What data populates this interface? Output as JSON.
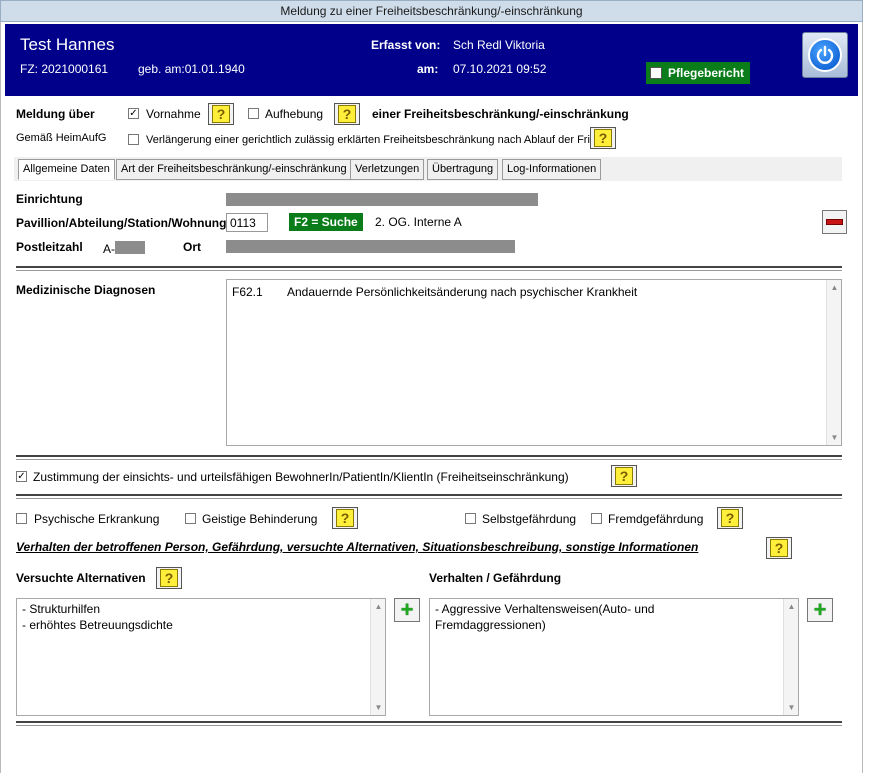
{
  "window": {
    "title": "Meldung zu einer Freiheitsbeschränkung/-einschränkung"
  },
  "header": {
    "name": "Test Hannes",
    "fz": "FZ: 2021000161",
    "geb": "geb. am:01.01.1940",
    "erfasst_label": "Erfasst von:",
    "erfasst_value": "Sch Redl Viktoria",
    "am_label": "am:",
    "am_value": "07.10.2021 09:52",
    "pflegebericht": "Pflegebericht"
  },
  "meldung": {
    "label": "Meldung über",
    "vornahme": "Vornahme",
    "vornahme_checked": true,
    "aufhebung": "Aufhebung",
    "aufhebung_checked": false,
    "suffix": "einer Freiheitsbeschränkung/-einschränkung",
    "gemaess": "Gemäß HeimAufG",
    "verlaengerung": "Verlängerung einer gerichtlich zulässig erklärten Freiheitsbeschränkung nach Ablauf der Frist",
    "verlaengerung_checked": false
  },
  "tabs": [
    {
      "label": "Allgemeine Daten",
      "active": true
    },
    {
      "label": "Art der Freiheitsbeschränkung/-einschränkung",
      "active": false
    },
    {
      "label": "Verletzungen",
      "active": false
    },
    {
      "label": "Übertragung",
      "active": false
    },
    {
      "label": "Log-Informationen",
      "active": false
    }
  ],
  "general": {
    "einrichtung_label": "Einrichtung",
    "pavillon_label": "Pavillion/Abteilung/Station/Wohnung",
    "pavillon_value": "0113",
    "f2_label": "F2 = Suche",
    "station_text": "2. OG. Interne A",
    "plz_label": "Postleitzahl",
    "plz_prefix": "A-",
    "ort_label": "Ort"
  },
  "diagnosen": {
    "label": "Medizinische Diagnosen",
    "code": "F62.1",
    "text": "Andauernde Persönlichkeitsänderung nach psychischer Krankheit"
  },
  "zustimmung": {
    "label": "Zustimmung der einsichts- und urteilsfähigen BewohnerIn/PatientIn/KlientIn (Freiheitseinschränkung)",
    "checked": true
  },
  "conditions": {
    "psychisch": "Psychische Erkrankung",
    "geistig": "Geistige Behinderung",
    "selbst": "Selbstgefährdung",
    "fremd": "Fremdgefährdung"
  },
  "verhalten": {
    "heading": "Verhalten der betroffenen Person, Gefährdung, versuchte Alternativen, Situationsbeschreibung, sonstige Informationen",
    "alternativen_label": "Versuchte Alternativen",
    "alternativen_items": [
      "- Strukturhilfen",
      "- erhöhtes Betreuungsdichte"
    ],
    "gefaehrdung_label": "Verhalten / Gefährdung",
    "gefaehrdung_line1": "- Aggressive Verhaltensweisen(Auto- und",
    "gefaehrdung_line2": "Fremdaggressionen)"
  },
  "colors": {
    "header_bg": "#00008b",
    "green": "#0a7d1a",
    "titlebar": "#cfdce9"
  }
}
